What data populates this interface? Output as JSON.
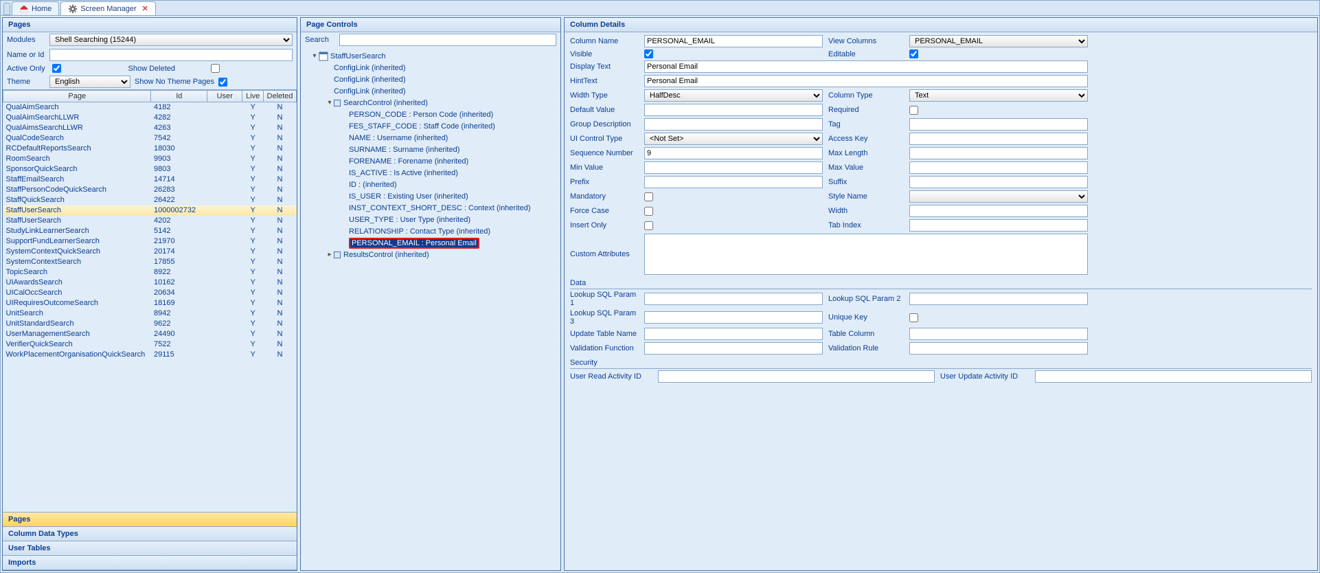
{
  "tabs": {
    "home": "Home",
    "mgr": "Screen Manager"
  },
  "left": {
    "title": "Pages",
    "labels": {
      "modules": "Modules",
      "nameorid": "Name or Id",
      "activeonly": "Active Only",
      "showdeleted": "Show Deleted",
      "theme": "Theme",
      "shownotheme": "Show No Theme Pages"
    },
    "modules_sel": "Shell Searching (15244)",
    "theme_sel": "English",
    "active_only": true,
    "show_deleted": false,
    "show_no_theme": true,
    "cols": {
      "page": "Page",
      "id": "Id",
      "user": "User",
      "live": "Live",
      "deleted": "Deleted"
    },
    "rows": [
      {
        "page": "QualAimSearch",
        "id": "4182",
        "live": "Y",
        "del": "N"
      },
      {
        "page": "QualAimSearchLLWR",
        "id": "4282",
        "live": "Y",
        "del": "N"
      },
      {
        "page": "QualAimsSearchLLWR",
        "id": "4263",
        "live": "Y",
        "del": "N"
      },
      {
        "page": "QualCodeSearch",
        "id": "7542",
        "live": "Y",
        "del": "N"
      },
      {
        "page": "RCDefaultReportsSearch",
        "id": "18030",
        "live": "Y",
        "del": "N"
      },
      {
        "page": "RoomSearch",
        "id": "9903",
        "live": "Y",
        "del": "N"
      },
      {
        "page": "SponsorQuickSearch",
        "id": "9803",
        "live": "Y",
        "del": "N"
      },
      {
        "page": "StaffEmailSearch",
        "id": "14714",
        "live": "Y",
        "del": "N"
      },
      {
        "page": "StaffPersonCodeQuickSearch",
        "id": "26283",
        "live": "Y",
        "del": "N"
      },
      {
        "page": "StaffQuickSearch",
        "id": "26422",
        "live": "Y",
        "del": "N"
      },
      {
        "page": "StaffUserSearch",
        "id": "1000002732",
        "live": "Y",
        "del": "N",
        "sel": true
      },
      {
        "page": "StaffUserSearch",
        "id": "4202",
        "live": "Y",
        "del": "N"
      },
      {
        "page": "StudyLinkLearnerSearch",
        "id": "5142",
        "live": "Y",
        "del": "N"
      },
      {
        "page": "SupportFundLearnerSearch",
        "id": "21970",
        "live": "Y",
        "del": "N"
      },
      {
        "page": "SystemContextQuickSearch",
        "id": "20174",
        "live": "Y",
        "del": "N"
      },
      {
        "page": "SystemContextSearch",
        "id": "17855",
        "live": "Y",
        "del": "N"
      },
      {
        "page": "TopicSearch",
        "id": "8922",
        "live": "Y",
        "del": "N"
      },
      {
        "page": "UIAwardsSearch",
        "id": "10162",
        "live": "Y",
        "del": "N"
      },
      {
        "page": "UICalOccSearch",
        "id": "20634",
        "live": "Y",
        "del": "N"
      },
      {
        "page": "UIRequiresOutcomeSearch",
        "id": "18169",
        "live": "Y",
        "del": "N"
      },
      {
        "page": "UnitSearch",
        "id": "8942",
        "live": "Y",
        "del": "N"
      },
      {
        "page": "UnitStandardSearch",
        "id": "9622",
        "live": "Y",
        "del": "N"
      },
      {
        "page": "UserManagementSearch",
        "id": "24490",
        "live": "Y",
        "del": "N"
      },
      {
        "page": "VerifierQuickSearch",
        "id": "7522",
        "live": "Y",
        "del": "N"
      },
      {
        "page": "WorkPlacementOrganisationQuickSearch",
        "id": "29115",
        "live": "Y",
        "del": "N"
      }
    ],
    "acc": {
      "pages": "Pages",
      "cdt": "Column Data Types",
      "ut": "User Tables",
      "imp": "Imports"
    }
  },
  "mid": {
    "title": "Page Controls",
    "search": "Search",
    "tree": [
      {
        "d": 0,
        "tw": "▾",
        "sq": false,
        "t": "StaffUserSearch",
        "icon": true
      },
      {
        "d": 1,
        "tw": "",
        "sq": false,
        "t": "ConfigLink (inherited)"
      },
      {
        "d": 1,
        "tw": "",
        "sq": false,
        "t": "ConfigLink (inherited)"
      },
      {
        "d": 1,
        "tw": "",
        "sq": false,
        "t": "ConfigLink (inherited)"
      },
      {
        "d": 1,
        "tw": "▾",
        "sq": true,
        "t": "SearchControl (inherited)"
      },
      {
        "d": 2,
        "tw": "",
        "sq": false,
        "t": "PERSON_CODE : Person Code (inherited)"
      },
      {
        "d": 2,
        "tw": "",
        "sq": false,
        "t": "FES_STAFF_CODE : Staff Code (inherited)"
      },
      {
        "d": 2,
        "tw": "",
        "sq": false,
        "t": "NAME : Username (inherited)"
      },
      {
        "d": 2,
        "tw": "",
        "sq": false,
        "t": "SURNAME : Surname (inherited)"
      },
      {
        "d": 2,
        "tw": "",
        "sq": false,
        "t": "FORENAME : Forename (inherited)"
      },
      {
        "d": 2,
        "tw": "",
        "sq": false,
        "t": "IS_ACTIVE : Is Active (inherited)"
      },
      {
        "d": 2,
        "tw": "",
        "sq": false,
        "t": "ID :  (inherited)"
      },
      {
        "d": 2,
        "tw": "",
        "sq": false,
        "t": "IS_USER : Existing User (inherited)"
      },
      {
        "d": 2,
        "tw": "",
        "sq": false,
        "t": "INST_CONTEXT_SHORT_DESC : Context (inherited)"
      },
      {
        "d": 2,
        "tw": "",
        "sq": false,
        "t": "USER_TYPE : User Type (inherited)"
      },
      {
        "d": 2,
        "tw": "",
        "sq": false,
        "t": "RELATIONSHIP : Contact Type (inherited)"
      },
      {
        "d": 2,
        "tw": "",
        "sq": false,
        "t": "PERSONAL_EMAIL : Personal Email",
        "hl": true
      },
      {
        "d": 1,
        "tw": "▸",
        "sq": true,
        "t": "ResultsControl (inherited)"
      }
    ]
  },
  "right": {
    "title": "Column Details",
    "f": {
      "column_name": "Column Name",
      "view_columns": "View Columns",
      "visible": "Visible",
      "editable": "Editable",
      "display_text": "Display Text",
      "hint_text": "HintText",
      "width_type": "Width Type",
      "column_type": "Column Type",
      "default_value": "Default Value",
      "required": "Required",
      "group_desc": "Group Description",
      "tag": "Tag",
      "ui_control": "UI Control Type",
      "access_key": "Access Key",
      "seq": "Sequence Number",
      "max_len": "Max Length",
      "min_val": "Min Value",
      "max_val": "Max Value",
      "prefix": "Prefix",
      "suffix": "Suffix",
      "mandatory": "Mandatory",
      "style": "Style Name",
      "force_case": "Force Case",
      "width": "Width",
      "insert_only": "Insert Only",
      "tab_index": "Tab Index",
      "custom": "Custom Attributes",
      "data": "Data",
      "lsp1": "Lookup SQL Param 1",
      "lsp2": "Lookup SQL Param 2",
      "lsp3": "Lookup SQL Param 3",
      "ukey": "Unique Key",
      "utn": "Update Table Name",
      "tcol": "Table Column",
      "vfn": "Validation Function",
      "vrule": "Validation Rule",
      "sec": "Security",
      "uraid": "User Read Activity ID",
      "uuaid": "User Update Activity ID"
    },
    "v": {
      "column_name": "PERSONAL_EMAIL",
      "view_columns": "PERSONAL_EMAIL",
      "visible": true,
      "editable": true,
      "display_text": "Personal Email",
      "hint_text": "Personal Email",
      "width_type": "HalfDesc",
      "column_type": "Text",
      "default_value": "",
      "required": false,
      "group_desc": "",
      "tag": "",
      "ui_control": "<Not Set>",
      "access_key": "",
      "seq": "9",
      "max_len": "",
      "min_val": "",
      "max_val": "",
      "prefix": "",
      "suffix": "",
      "mandatory": false,
      "style": "",
      "force_case": false,
      "width": "",
      "insert_only": false,
      "tab_index": "",
      "custom": "",
      "lsp1": "",
      "lsp2": "",
      "lsp3": "",
      "ukey": false,
      "utn": "",
      "tcol": "",
      "vfn": "",
      "vrule": "",
      "uraid": "",
      "uuaid": ""
    }
  }
}
